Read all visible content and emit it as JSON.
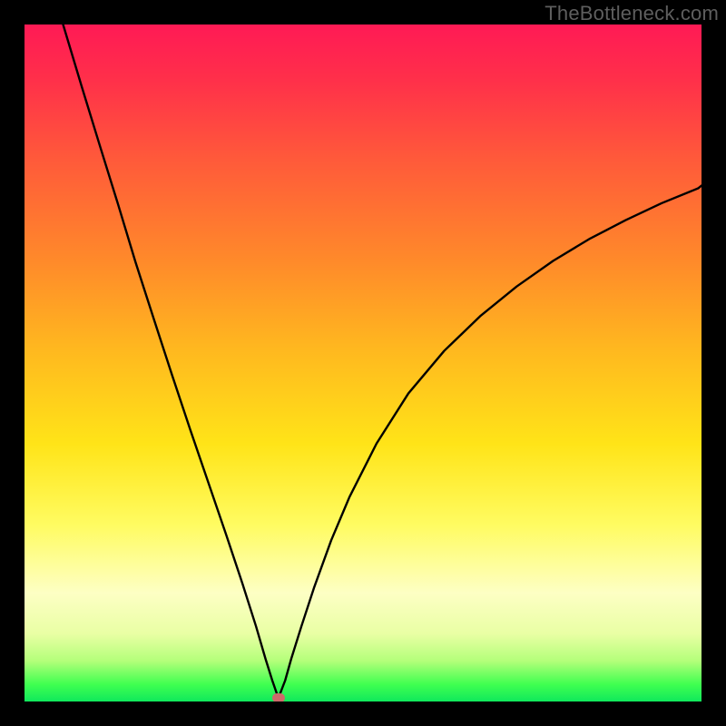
{
  "watermark": "TheBottleneck.com",
  "chart_data": {
    "type": "line",
    "title": "",
    "xlabel": "",
    "ylabel": "",
    "xlim": [
      0,
      1
    ],
    "ylim": [
      0,
      1
    ],
    "grid": false,
    "legend": false,
    "gradient_stops": [
      {
        "offset": 0.0,
        "color": "#ff1a55"
      },
      {
        "offset": 0.08,
        "color": "#ff2f4a"
      },
      {
        "offset": 0.2,
        "color": "#ff5a3a"
      },
      {
        "offset": 0.35,
        "color": "#ff8a2a"
      },
      {
        "offset": 0.48,
        "color": "#ffb81f"
      },
      {
        "offset": 0.62,
        "color": "#ffe418"
      },
      {
        "offset": 0.74,
        "color": "#fffc62"
      },
      {
        "offset": 0.84,
        "color": "#fdffc4"
      },
      {
        "offset": 0.9,
        "color": "#e9ffa4"
      },
      {
        "offset": 0.94,
        "color": "#b4ff7a"
      },
      {
        "offset": 0.975,
        "color": "#3fff50"
      },
      {
        "offset": 1.0,
        "color": "#10e85c"
      }
    ],
    "series": [
      {
        "name": "curve",
        "color": "#000000",
        "min_point": {
          "x": 0.375,
          "y": 0.005
        },
        "x": [
          0.057,
          0.084,
          0.111,
          0.138,
          0.164,
          0.191,
          0.218,
          0.245,
          0.272,
          0.298,
          0.322,
          0.342,
          0.356,
          0.366,
          0.375,
          0.385,
          0.394,
          0.409,
          0.428,
          0.453,
          0.48,
          0.52,
          0.567,
          0.62,
          0.674,
          0.727,
          0.781,
          0.834,
          0.888,
          0.941,
          0.995,
          1.0
        ],
        "y": [
          1.0,
          0.91,
          0.822,
          0.735,
          0.649,
          0.565,
          0.482,
          0.401,
          0.322,
          0.246,
          0.174,
          0.111,
          0.063,
          0.031,
          0.005,
          0.031,
          0.063,
          0.111,
          0.169,
          0.238,
          0.302,
          0.381,
          0.455,
          0.518,
          0.57,
          0.613,
          0.651,
          0.683,
          0.711,
          0.736,
          0.758,
          0.762
        ]
      }
    ],
    "marker": {
      "label": "",
      "color": "#cd6a6a"
    }
  }
}
